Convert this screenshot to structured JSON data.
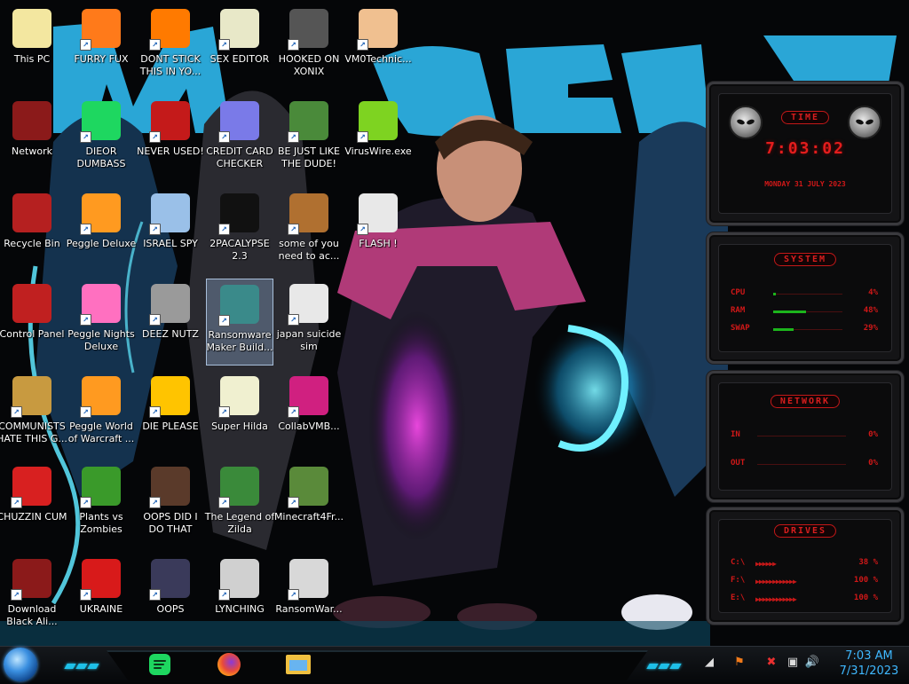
{
  "desktop": {
    "icons": [
      {
        "label": "This PC",
        "icon": "this-pc-icon",
        "color": "#f3e7a0"
      },
      {
        "label": "FURRY FUX",
        "icon": "firefox-icon",
        "color": "#ff7a1a"
      },
      {
        "label": "DONT STICK THIS IN YO...",
        "icon": "traffic-cone-icon",
        "color": "#ff7a00"
      },
      {
        "label": "SEX EDITOR",
        "icon": "hex-editor-icon",
        "color": "#e8e8c8"
      },
      {
        "label": "HOOKED ON XONIX",
        "icon": "xonix-game-icon",
        "color": "#555555"
      },
      {
        "label": "VM0Technic...",
        "icon": "technician-person-icon",
        "color": "#f0c090"
      },
      {
        "label": "Network",
        "icon": "alienware-orb-icon",
        "color": "#8b1a1a"
      },
      {
        "label": "DIEOR DUMBASS",
        "icon": "spotify-green-icon",
        "color": "#1ed760"
      },
      {
        "label": "NEVER USED!",
        "icon": "dev-plus-plus-icon",
        "color": "#c41a1a"
      },
      {
        "label": "CREDIT CARD CHECKER",
        "icon": "credit-card-icon",
        "color": "#7a7ae8"
      },
      {
        "label": "BE JUST LIKE THE DUDE!",
        "icon": "gnome-face-icon",
        "color": "#4a8a3a"
      },
      {
        "label": "VirusWire.exe",
        "icon": "limewire-icon",
        "color": "#7ed321"
      },
      {
        "label": "Recycle Bin",
        "icon": "recycle-bin-icon",
        "color": "#b52020"
      },
      {
        "label": "Peggle Deluxe",
        "icon": "peggle-icon",
        "color": "#ff9a20"
      },
      {
        "label": "ISRAEL SPY",
        "icon": "computer-monitor-icon",
        "color": "#9ac0e8"
      },
      {
        "label": "2PACALYPSE 2.3",
        "icon": "command-prompt-icon",
        "color": "#111111"
      },
      {
        "label": "some of you need to ac...",
        "icon": "bear-icon",
        "color": "#b07030"
      },
      {
        "label": "FLASH !",
        "icon": "flash-document-icon",
        "color": "#e8e8e8"
      },
      {
        "label": "Control Panel",
        "icon": "control-panel-icon",
        "color": "#c02020"
      },
      {
        "label": "Peggle Nights Deluxe",
        "icon": "peggle-nights-icon",
        "color": "#ff70c0"
      },
      {
        "label": "DEEZ NUTZ",
        "icon": "stacked-windows-icon",
        "color": "#9a9a9a"
      },
      {
        "label": "Ransomware Maker Build...",
        "icon": "ransomware-builder-icon",
        "color": "#3a8a8a"
      },
      {
        "label": "japan suicide sim",
        "icon": "installer-package-icon",
        "color": "#e8e8e8"
      },
      {
        "label": "COMMUNISTS HATE THIS G...",
        "icon": "money-bag-icon",
        "color": "#c89a40"
      },
      {
        "label": "Peggle World of Warcraft ...",
        "icon": "peggle-wow-icon",
        "color": "#ff9a20"
      },
      {
        "label": "DIE PLEASE",
        "icon": "de-letters-icon",
        "color": "#ffc400"
      },
      {
        "label": "Super Hilda",
        "icon": "pixel-character-icon",
        "color": "#f0f0d0"
      },
      {
        "label": "CollabVMB...",
        "icon": "collabvm-monitor-icon",
        "color": "#d02080"
      },
      {
        "label": "CHUZZIN CUM",
        "icon": "chuzzle-red-icon",
        "color": "#d82020"
      },
      {
        "label": "Plants vs Zombies",
        "icon": "plants-vs-zombies-icon",
        "color": "#3a9a2a"
      },
      {
        "label": "OOPS DID I DO THAT",
        "icon": "portrait-painting-icon",
        "color": "#5a3a2a"
      },
      {
        "label": "The Legend of Zilda",
        "icon": "pixel-hero-icon",
        "color": "#3a8a3a"
      },
      {
        "label": "Minecraft4Fr...",
        "icon": "minecraft-block-icon",
        "color": "#5a8a3a"
      },
      {
        "label": "Download Black Ali...",
        "icon": "alienware-orb-icon",
        "color": "#8b1a1a"
      },
      {
        "label": "UKRAINE",
        "icon": "radiation-symbol-icon",
        "color": "#d81a1a"
      },
      {
        "label": "OOPS",
        "icon": "book-icon",
        "color": "#3a3a5a"
      },
      {
        "label": "LYNCHING",
        "icon": "knot-emblem-icon",
        "color": "#d0d0d0"
      },
      {
        "label": "RansomWar...",
        "icon": "skull-icon",
        "color": "#d8d8d8"
      }
    ]
  },
  "gadgets": {
    "time": {
      "title": "TIME",
      "clock": "7:03:02",
      "date": "MONDAY 31 JULY 2023"
    },
    "system": {
      "title": "SYSTEM",
      "rows": [
        {
          "label": "CPU",
          "value": "4%",
          "fraction": 0.04
        },
        {
          "label": "RAM",
          "value": "48%",
          "fraction": 0.48
        },
        {
          "label": "SWAP",
          "value": "29%",
          "fraction": 0.29
        }
      ]
    },
    "network": {
      "title": "NETWORK",
      "rows": [
        {
          "label": "IN",
          "value": "0%"
        },
        {
          "label": "OUT",
          "value": "0%"
        }
      ]
    },
    "drives": {
      "title": "DRIVES",
      "rows": [
        {
          "label": "C:\\",
          "value": "38 %"
        },
        {
          "label": "F:\\",
          "value": "100 %"
        },
        {
          "label": "E:\\",
          "value": "100 %"
        }
      ]
    }
  },
  "taskbar": {
    "apps": [
      {
        "icon": "spotify-icon",
        "color": "#1ed760"
      },
      {
        "icon": "firefox-icon",
        "color": "#ff7a1a"
      },
      {
        "icon": "file-explorer-icon",
        "color": "#f0c040"
      }
    ],
    "tray": {
      "time": "7:03 AM",
      "date": "7/31/2023"
    },
    "accent": "#1ec0e8"
  }
}
